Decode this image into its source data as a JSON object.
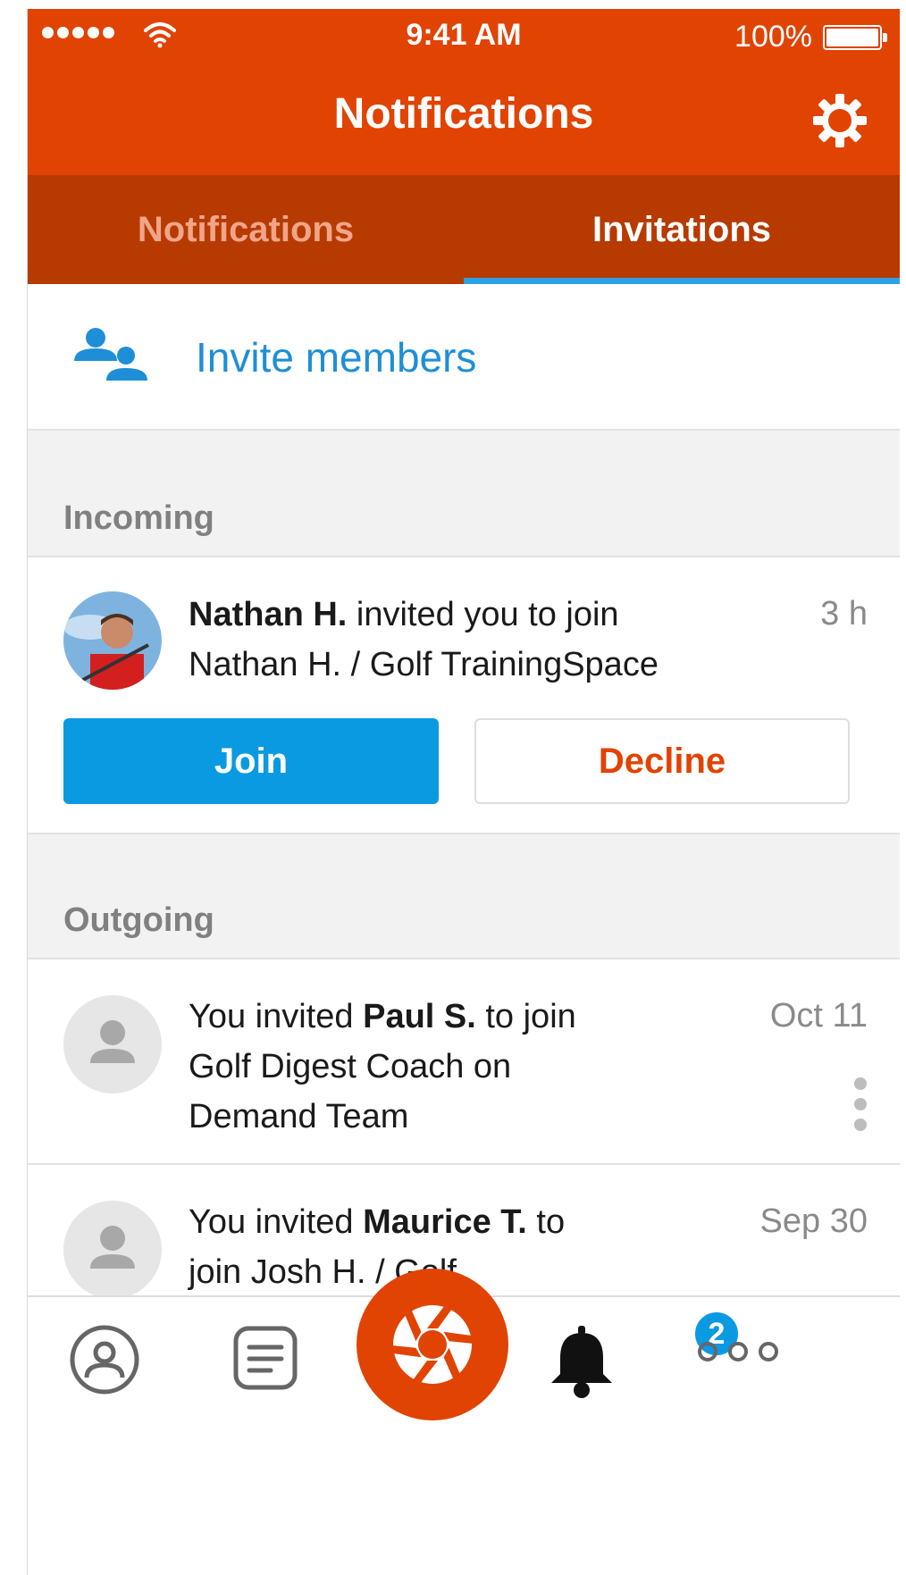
{
  "status_bar": {
    "time": "9:41 AM",
    "battery": "100%"
  },
  "nav": {
    "title": "Notifications"
  },
  "tabs": [
    {
      "label": "Notifications",
      "active": false
    },
    {
      "label": "Invitations",
      "active": true
    }
  ],
  "invite": {
    "label": "Invite members"
  },
  "incoming": {
    "header": "Incoming",
    "item": {
      "name": "Nathan H.",
      "text": " invited you to join",
      "line2": "Nathan H. / Golf TrainingSpace",
      "time": "3 h",
      "join_label": "Join",
      "decline_label": "Decline"
    }
  },
  "outgoing": {
    "header": "Outgoing",
    "items": [
      {
        "prefix": "You invited ",
        "name": "Paul S.",
        "suffix": " to join",
        "line2": "Golf Digest Coach on",
        "line3": "Demand Team",
        "date": "Oct 11"
      },
      {
        "prefix": "You invited ",
        "name": "Maurice T.",
        "suffix": " to",
        "line2": "join Josh H. / Golf",
        "date": "Sep 30"
      }
    ]
  },
  "tabbar": {
    "badge_count": "2"
  },
  "colors": {
    "brand": "#e14303",
    "tabbar_dark": "#b73a00",
    "accent_blue": "#0a9ae2",
    "link_blue": "#1e8fd6"
  }
}
